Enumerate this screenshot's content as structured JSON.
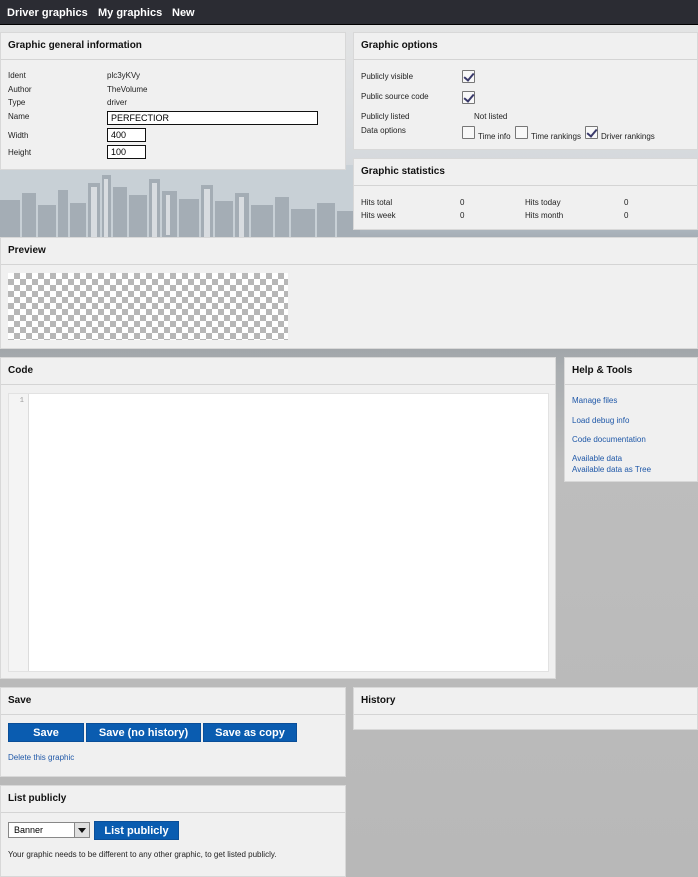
{
  "nav": {
    "items": [
      "Driver graphics",
      "My graphics",
      "New"
    ]
  },
  "general": {
    "title": "Graphic general information",
    "labels": {
      "ident": "Ident",
      "author": "Author",
      "type": "Type",
      "name": "Name",
      "width": "Width",
      "height": "Height"
    },
    "values": {
      "ident": "plc3yKVy",
      "author": "TheVolume",
      "type": "driver",
      "name": "PERFECTIOR",
      "width": "400",
      "height": "100"
    }
  },
  "options": {
    "title": "Graphic options",
    "labels": {
      "publicly_visible": "Publicly visible",
      "public_source": "Public source code",
      "publicly_listed": "Publicly listed",
      "data_options": "Data options"
    },
    "publicly_visible": true,
    "public_source": true,
    "listed_value": "Not listed",
    "data_opts": [
      {
        "label": "Time info",
        "checked": false
      },
      {
        "label": "Time rankings",
        "checked": false
      },
      {
        "label": "Driver rankings",
        "checked": true
      }
    ]
  },
  "stats": {
    "title": "Graphic statistics",
    "labels": {
      "hits_total": "Hits total",
      "hits_week": "Hits week",
      "hits_today": "Hits today",
      "hits_month": "Hits month"
    },
    "values": {
      "hits_total": "0",
      "hits_week": "0",
      "hits_today": "0",
      "hits_month": "0"
    }
  },
  "preview": {
    "title": "Preview"
  },
  "code": {
    "title": "Code",
    "line": "1"
  },
  "help": {
    "title": "Help & Tools",
    "links": [
      "Manage files",
      "Load debug info",
      "Code documentation",
      "Available data",
      "Available data as Tree"
    ]
  },
  "save": {
    "title": "Save",
    "buttons": [
      "Save",
      "Save (no history)",
      "Save as copy"
    ],
    "delete_link": "Delete this graphic"
  },
  "history": {
    "title": "History"
  },
  "listpub": {
    "title": "List publicly",
    "select_value": "Banner",
    "button": "List publicly",
    "note": "Your graphic needs to be different to any other graphic, to get listed publicly."
  },
  "colors": {
    "topbar": "#2b2c33",
    "button": "#0a5cb0",
    "link": "#1f58a8",
    "panel": "#f0f0f0"
  }
}
